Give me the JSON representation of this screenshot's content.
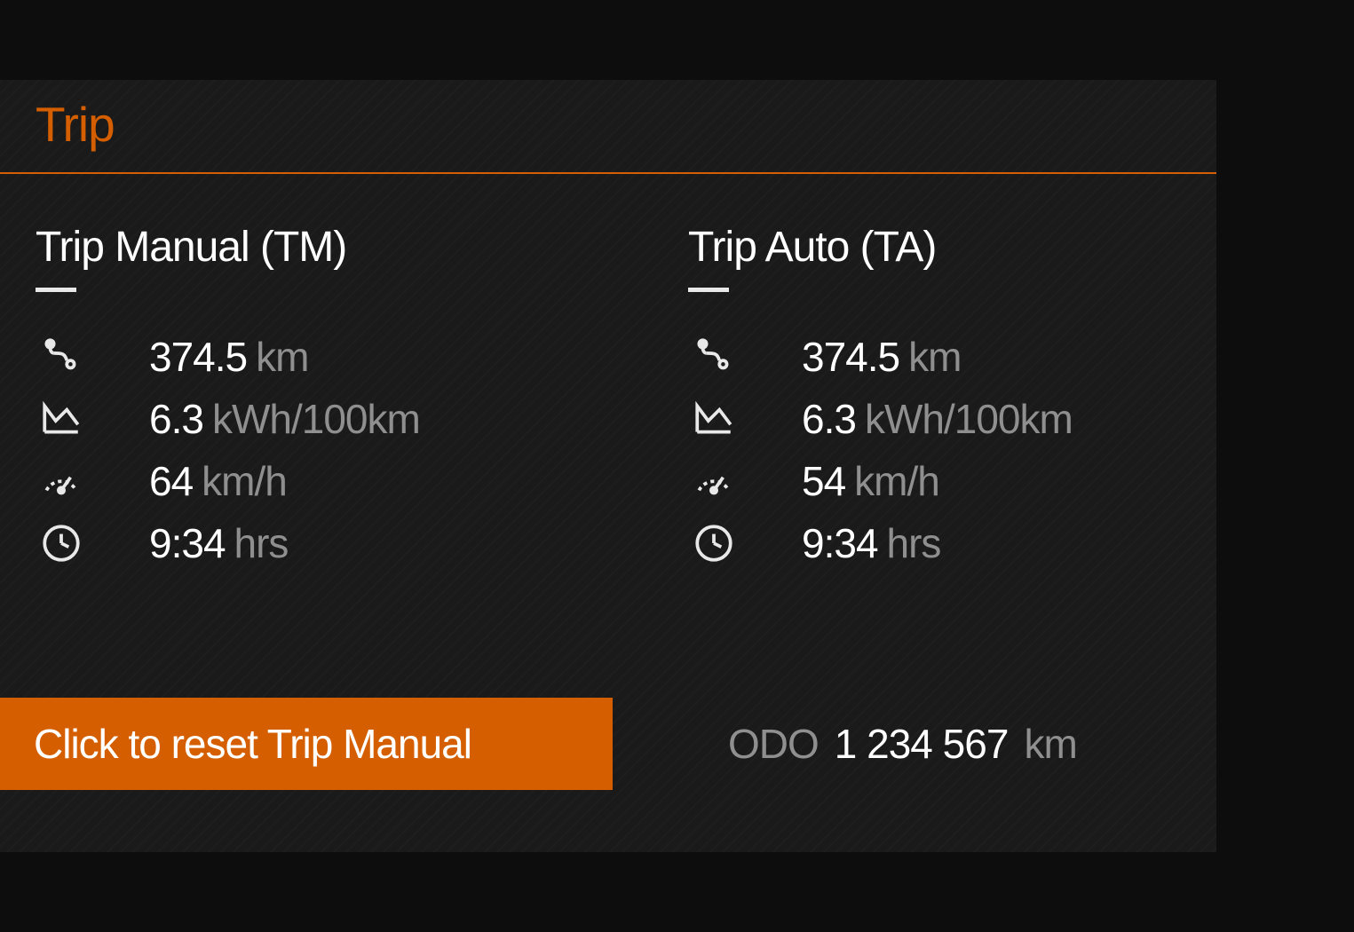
{
  "colors": {
    "accent": "#d55f00",
    "bg": "#1a1a1a",
    "text": "#ffffff",
    "muted": "#8f8f8f"
  },
  "header": {
    "title": "Trip"
  },
  "manual": {
    "title": "Trip Manual (TM)",
    "distance": {
      "value": "374.5",
      "unit": "km"
    },
    "consumption": {
      "value": "6.3",
      "unit": "kWh/100km"
    },
    "speed": {
      "value": "64",
      "unit": "km/h"
    },
    "time": {
      "value": "9:34",
      "unit": "hrs"
    }
  },
  "auto": {
    "title": "Trip Auto (TA)",
    "distance": {
      "value": "374.5",
      "unit": "km"
    },
    "consumption": {
      "value": "6.3",
      "unit": "kWh/100km"
    },
    "speed": {
      "value": "54",
      "unit": "km/h"
    },
    "time": {
      "value": "9:34",
      "unit": "hrs"
    }
  },
  "reset_button": "Click to reset Trip Manual",
  "odometer": {
    "label": "ODO",
    "value": "1 234 567",
    "unit": "km"
  }
}
